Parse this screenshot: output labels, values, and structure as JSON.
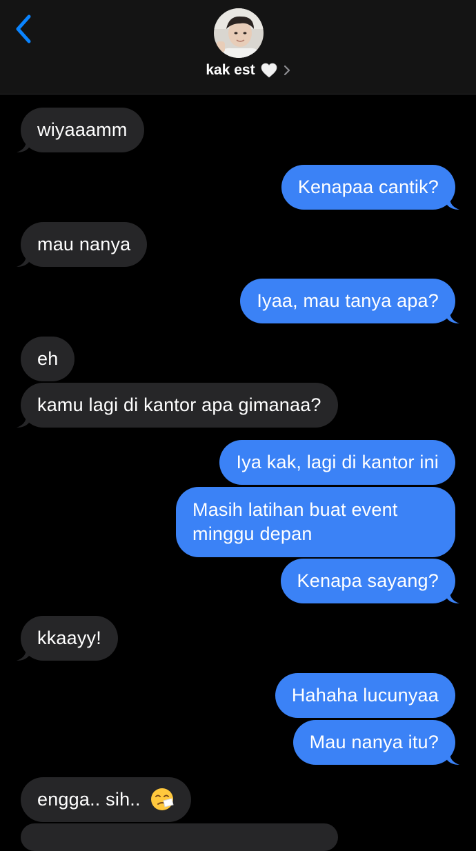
{
  "header": {
    "back_icon": "chevron-left-icon",
    "contact_name": "kak est",
    "heart_icon": "white-heart-icon",
    "chevron_icon": "chevron-right-icon"
  },
  "colors": {
    "background": "#000000",
    "header_bg": "#141414",
    "received_bubble": "#262628",
    "sent_bubble": "#3b82f6",
    "accent": "#0a84ff"
  },
  "messages": [
    {
      "side": "received",
      "text": "wiyaaamm"
    },
    {
      "side": "sent",
      "text": "Kenapaa cantik?"
    },
    {
      "side": "received",
      "text": "mau nanya"
    },
    {
      "side": "sent",
      "text": "Iyaa, mau tanya apa?"
    },
    {
      "side": "received",
      "text": "eh"
    },
    {
      "side": "received",
      "text": "kamu lagi di kantor apa gimanaa?"
    },
    {
      "side": "sent",
      "text": "Iya kak, lagi di kantor ini"
    },
    {
      "side": "sent",
      "text": "Masih latihan buat event minggu depan"
    },
    {
      "side": "sent",
      "text": "Kenapa sayang?"
    },
    {
      "side": "received",
      "text": "kkaayy!"
    },
    {
      "side": "sent",
      "text": "Hahaha lucunyaa"
    },
    {
      "side": "sent",
      "text": "Mau nanya itu?"
    },
    {
      "side": "received",
      "text": "engga.. sih..",
      "emoji": "sneezing-face-icon"
    }
  ]
}
